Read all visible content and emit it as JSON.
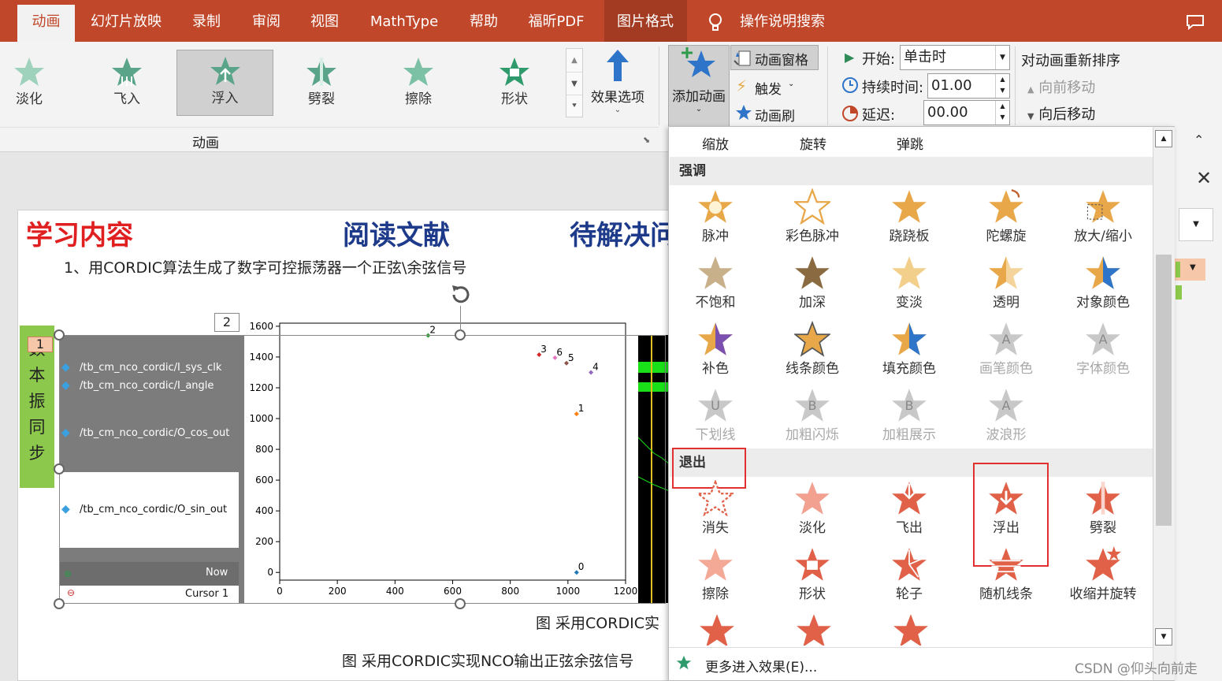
{
  "tabs": [
    "动画",
    "幻灯片放映",
    "录制",
    "审阅",
    "视图",
    "MathType",
    "帮助",
    "福昕PDF",
    "图片格式",
    "操作说明搜索"
  ],
  "ribbon": {
    "gallery": [
      "淡化",
      "飞入",
      "浮入",
      "劈裂",
      "擦除",
      "形状"
    ],
    "gallery_selected": "浮入",
    "effect_options": "效果选项",
    "group_label": "动画",
    "add_animation": "添加动画",
    "animation_pane": "动画窗格",
    "trigger": "触发",
    "animation_painter": "动画刷",
    "start_label": "开始:",
    "start_value": "单击时",
    "duration_label": "持续时间:",
    "duration_value": "01.00",
    "delay_label": "延迟:",
    "delay_value": "00.00",
    "reorder_title": "对动画重新排序",
    "move_earlier": "向前移动",
    "move_later": "向后移动"
  },
  "slide": {
    "heading1": "学习内容",
    "heading2": "阅读文献",
    "heading3": "待解决问",
    "line1": "1、用CORDIC算法生成了数字可控振荡器一个正弦\\余弦信号",
    "side_label": "数本振同步",
    "anim_tag1": "1",
    "anim_tag2": "2",
    "caption1": "图 采用CORDIC实",
    "caption2": "图 采用CORDIC实现NCO输出正弦余弦信号",
    "waves": [
      "/tb_cm_nco_cordic/I_sys_clk",
      "/tb_cm_nco_cordic/I_angle",
      "/tb_cm_nco_cordic/O_cos_out",
      "/tb_cm_nco_cordic/O_sin_out"
    ],
    "now_label": "Now",
    "cursor_label": "Cursor 1"
  },
  "chart_data": {
    "type": "scatter",
    "x_ticks": [
      "0",
      "200",
      "400",
      "600",
      "800",
      "1000",
      "1200"
    ],
    "y_ticks": [
      "0",
      "200",
      "400",
      "600",
      "800",
      "1000",
      "1200",
      "1400",
      "1600"
    ],
    "xlim": [
      0,
      1200
    ],
    "ylim": [
      -50,
      1620
    ],
    "points": [
      {
        "label": "0",
        "x": 1030,
        "y": 0,
        "color": "#1f77b4"
      },
      {
        "label": "1",
        "x": 1030,
        "y": 1030,
        "color": "#ff7f0e"
      },
      {
        "label": "2",
        "x": 515,
        "y": 1540,
        "color": "#2ca02c"
      },
      {
        "label": "3",
        "x": 900,
        "y": 1415,
        "color": "#d62728"
      },
      {
        "label": "4",
        "x": 1080,
        "y": 1300,
        "color": "#9467bd"
      },
      {
        "label": "5",
        "x": 995,
        "y": 1360,
        "color": "#8c564b"
      },
      {
        "label": "6",
        "x": 955,
        "y": 1395,
        "color": "#e377c2"
      }
    ]
  },
  "dropdown": {
    "top_row": [
      "缩放",
      "旋转",
      "弹跳"
    ],
    "emphasis_title": "强调",
    "emphasis": [
      {
        "label": "脉冲",
        "enabled": true
      },
      {
        "label": "彩色脉冲",
        "enabled": true
      },
      {
        "label": "跷跷板",
        "enabled": true
      },
      {
        "label": "陀螺旋",
        "enabled": true
      },
      {
        "label": "放大/缩小",
        "enabled": true
      },
      {
        "label": "不饱和",
        "enabled": true
      },
      {
        "label": "加深",
        "enabled": true
      },
      {
        "label": "变淡",
        "enabled": true
      },
      {
        "label": "透明",
        "enabled": true
      },
      {
        "label": "对象颜色",
        "enabled": true
      },
      {
        "label": "补色",
        "enabled": true
      },
      {
        "label": "线条颜色",
        "enabled": true
      },
      {
        "label": "填充颜色",
        "enabled": true
      },
      {
        "label": "画笔颜色",
        "enabled": false
      },
      {
        "label": "字体颜色",
        "enabled": false
      },
      {
        "label": "下划线",
        "enabled": false
      },
      {
        "label": "加粗闪烁",
        "enabled": false
      },
      {
        "label": "加粗展示",
        "enabled": false
      },
      {
        "label": "波浪形",
        "enabled": false
      }
    ],
    "exit_title": "退出",
    "exit": [
      "消失",
      "淡化",
      "飞出",
      "浮出",
      "劈裂",
      "擦除",
      "形状",
      "轮子",
      "随机线条",
      "收缩并旋转"
    ],
    "more": "更多进入效果(E)..."
  },
  "watermark": "CSDN @仰头向前走",
  "colors": {
    "accent": "#c0472a",
    "entrance": "#5aa58a",
    "emphasis": "#e8a84a",
    "exit": "#e06048",
    "highlight_red": "#e03030"
  }
}
